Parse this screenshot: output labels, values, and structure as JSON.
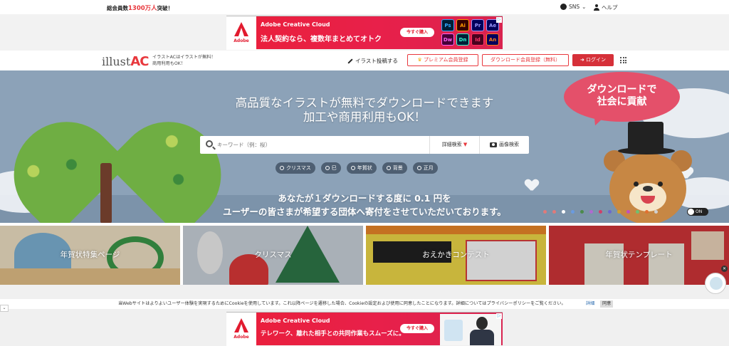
{
  "topbar": {
    "members_prefix": "総会員数",
    "members_count": "1300万人",
    "members_suffix": "突破！",
    "sns_label": "SNS",
    "help_label": "ヘルプ"
  },
  "ad_top": {
    "logo_word": "Adobe",
    "brand": "Adobe Creative Cloud",
    "tagline": "法人契約なら、複数年まとめてオトク",
    "button": "今すぐ購入",
    "apps": [
      {
        "label": "Ps",
        "bg": "#001e36",
        "fg": "#31a8ff"
      },
      {
        "label": "Ai",
        "bg": "#330000",
        "fg": "#ff9a00"
      },
      {
        "label": "Pr",
        "bg": "#00005b",
        "fg": "#9999ff"
      },
      {
        "label": "Ae",
        "bg": "#00005b",
        "fg": "#9999ff"
      },
      {
        "label": "Dw",
        "bg": "#470137",
        "fg": "#ff61f6"
      },
      {
        "label": "Dn",
        "bg": "#001e36",
        "fg": "#31ffd2"
      },
      {
        "label": "Id",
        "bg": "#49021f",
        "fg": "#ff3366"
      },
      {
        "label": "An",
        "bg": "#00005b",
        "fg": "#ff7f18"
      }
    ]
  },
  "header": {
    "logo_text": "illust",
    "logo_ac": "AC",
    "logo_sub_1": "イラストACはイラストが無料！",
    "logo_sub_2": "商用利用もOK！",
    "post_label": "イラスト投稿する",
    "premium_label": "プレミアム会員登録",
    "dl_label": "ダウンロード会員登録（無料）",
    "login_label": "ログイン"
  },
  "hero": {
    "headline_1": "高品質なイラストが無料でダウンロードできます",
    "headline_2": "加工や商用利用もOK！",
    "search_placeholder": "キーワード（例：桜）",
    "detail_search": "詳細検索",
    "image_search": "画像検索",
    "tags": [
      "クリスマス",
      "巳",
      "年賀状",
      "背景",
      "正月"
    ],
    "donate_1": "あなたが１ダウンロードする度に 0.1 円を",
    "donate_2": "ユーザーの皆さまが希望する団体へ寄付をさせていただいております。",
    "bubble_1": "ダウンロードで",
    "bubble_2": "社会に貢献",
    "toggle_label": "ON",
    "dot_colors": [
      "#e07a7a",
      "#e07a7a",
      "#ffffff",
      "#6a9be0",
      "#4b8a4b",
      "#b06ad0",
      "#d0406a",
      "#6a6ad0",
      "#d0a030",
      "#c050c0",
      "#70c070",
      "#e07030",
      "#d0d0d0"
    ]
  },
  "banners": [
    {
      "label": "年賀状特集ページ"
    },
    {
      "label": "クリスマス"
    },
    {
      "label": "おえかきコンテスト"
    },
    {
      "label": "年賀状テンプレート"
    }
  ],
  "cookie": {
    "text": "当Webサイトはよりよいユーザー体験を実現するためにCookieを使用しています。これ以降ページを遷移した場合、Cookieの設定および使用に同意したことになります。詳細についてはプライバシーポリシーをご覧ください。",
    "detail": "詳細",
    "agree": "同意"
  },
  "ad_bottom": {
    "logo_word": "Adobe",
    "brand": "Adobe Creative Cloud",
    "tagline": "テレワーク、離れた相手との共同作業もスムーズに。",
    "button": "今すぐ購入"
  }
}
